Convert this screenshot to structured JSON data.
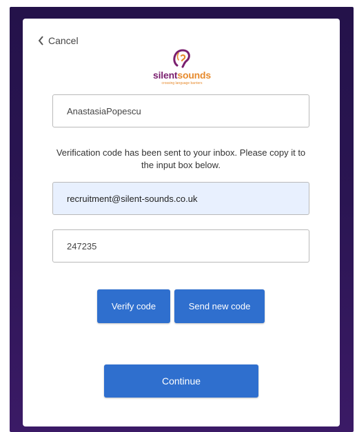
{
  "nav": {
    "cancel_label": "Cancel"
  },
  "brand": {
    "word_part1": "silent",
    "word_part2": "sounds",
    "tagline": "crossing language barriers",
    "primary_color": "#7a1f6f",
    "accent_color": "#e78b2e"
  },
  "form": {
    "username_value": "AnastasiaPopescu",
    "message": "Verification code has been sent to your inbox. Please copy it to the input box below.",
    "email_value": "recruitment@silent-sounds.co.uk",
    "code_value": "247235"
  },
  "buttons": {
    "verify_label": "Verify code",
    "send_new_label": "Send new code",
    "continue_label": "Continue",
    "color": "#2f6fce"
  }
}
